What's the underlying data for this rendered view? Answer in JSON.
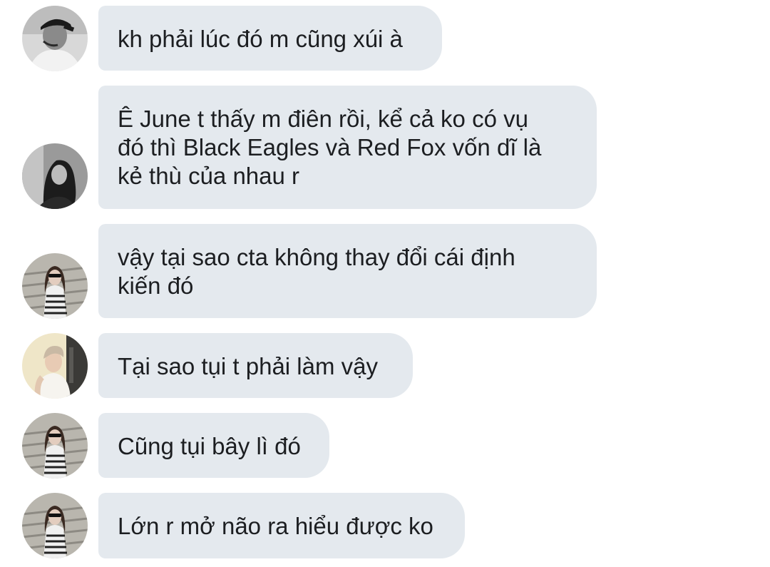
{
  "messages": [
    {
      "avatar": "avatar-man-in-cap-bw",
      "lines": [
        "kh phải lúc đó m cũng xúi à"
      ]
    },
    {
      "avatar": "avatar-woman-long-hair-bw",
      "lines": [
        "Ê June t thấy m điên rồi, kể cả ko có vụ",
        "đó thì Black Eagles và Red Fox vốn dĩ là",
        "kẻ thù của nhau r"
      ]
    },
    {
      "avatar": "avatar-woman-sunglasses-striped",
      "lines": [
        "vậy tại sao cta không thay đổi cái định",
        "kiến đó"
      ]
    },
    {
      "avatar": "avatar-man-white-tank",
      "lines": [
        "Tại sao tụi t phải làm vậy"
      ]
    },
    {
      "avatar": "avatar-woman-sunglasses-striped",
      "lines": [
        "Cũng tụi bây lì đó"
      ]
    },
    {
      "avatar": "avatar-woman-sunglasses-striped",
      "lines": [
        "Lớn r mở não ra hiểu được ko"
      ]
    }
  ],
  "colors": {
    "bubble": "#e4e9ee",
    "text": "#1c1e21",
    "background": "#ffffff"
  }
}
